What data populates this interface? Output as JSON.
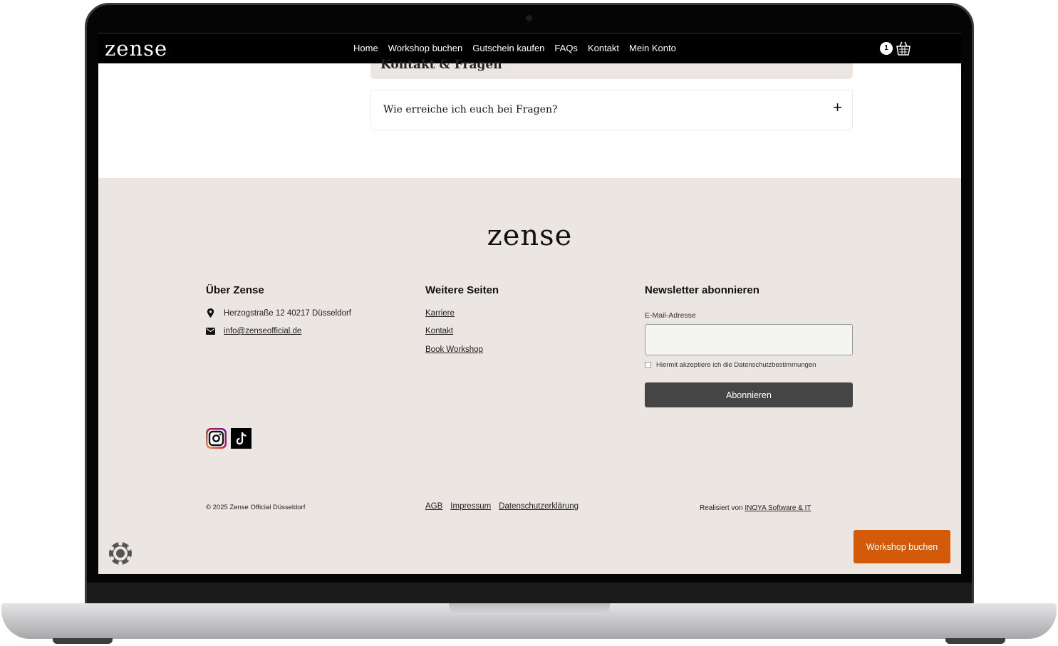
{
  "navbar": {
    "brand": "zense",
    "links": [
      "Home",
      "Workshop buchen",
      "Gutschein kaufen",
      "FAQs",
      "Kontakt",
      "Mein Konto"
    ],
    "cart_count": "1",
    "cart_icon": "shopping-basket-icon"
  },
  "faq": {
    "previous_title": "Kontakt & Fragen",
    "question": "Wie erreiche ich euch bei Fragen?",
    "toggle": "+"
  },
  "footer": {
    "logo": "zense",
    "about": {
      "title": "Über Zense",
      "address": "Herzogstraße 12 40217 Düsseldorf",
      "email": "info@zenseofficial.de"
    },
    "pages": {
      "title": "Weitere Seiten",
      "links": [
        "Karriere",
        "Kontakt",
        "Book Workshop"
      ]
    },
    "newsletter": {
      "title": "Newsletter abonnieren",
      "email_label": "E-Mail-Adresse",
      "email_value": "",
      "consent": "Hiermit akzeptiere ich die Datenschutzbestimmungen",
      "button": "Abonnieren"
    },
    "social": [
      "instagram-icon",
      "tiktok-icon"
    ],
    "copyright": "© 2025 Zense Official Düsseldorf",
    "legal_links": [
      "AGB",
      "Impressum",
      "Datenschutzerklärung"
    ],
    "credit_prefix": "Realisiert von",
    "credit_link": "INOYA Software & IT"
  },
  "cta": {
    "label": "Workshop buchen"
  },
  "colors": {
    "navbar_bg": "#000000",
    "footer_bg": "#ebe6e1",
    "subscribe_bg": "#454545",
    "cta_bg": "#d35a08"
  }
}
